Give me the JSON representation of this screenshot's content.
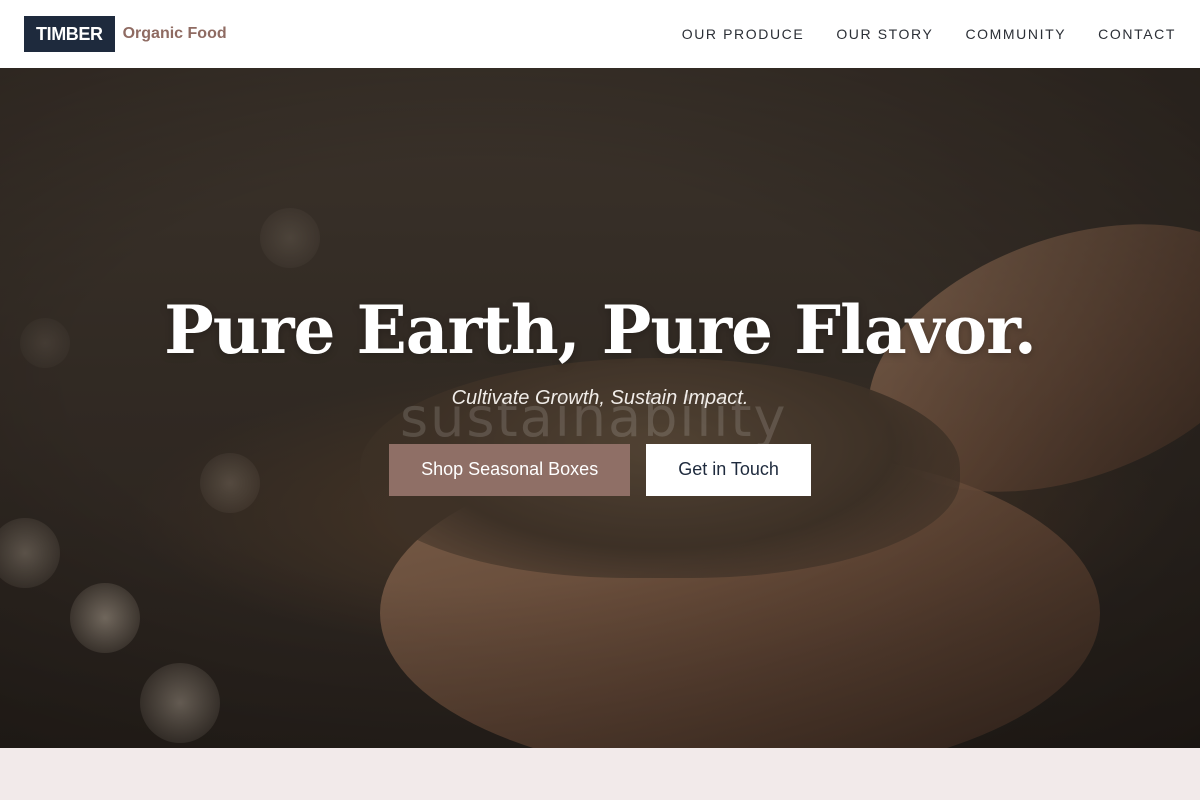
{
  "brand": {
    "name": "TIMBER",
    "tagline": "Organic Food"
  },
  "nav": {
    "items": [
      {
        "label": "OUR PRODUCE"
      },
      {
        "label": "OUR STORY"
      },
      {
        "label": "COMMUNITY"
      },
      {
        "label": "CONTACT"
      }
    ]
  },
  "hero": {
    "title": "Pure Earth, Pure Flavor.",
    "subtitle": "Cultivate Growth, Sustain Impact.",
    "background_text": "sustainability",
    "primary_cta": "Shop Seasonal Boxes",
    "secondary_cta": "Get in Touch"
  },
  "colors": {
    "brand_dark": "#1e2a3d",
    "accent": "#8f6f66",
    "tagline": "#8f6b62",
    "section_background": "#f2eaea"
  }
}
